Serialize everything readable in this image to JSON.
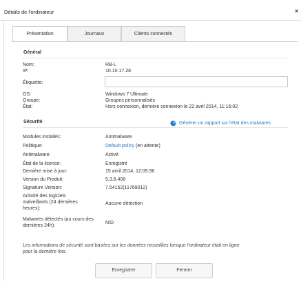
{
  "dialog": {
    "title": "Détails de l'ordinateur",
    "close_label": "×"
  },
  "tabs": [
    {
      "label": "Présentation",
      "active": true
    },
    {
      "label": "Journaux",
      "active": false
    },
    {
      "label": "Clients connectés",
      "active": false
    }
  ],
  "general": {
    "title": "Général",
    "name_label": "Nom:",
    "name_value": "RB-L",
    "ip_label": "IP:",
    "ip_value": "10.10.17.28",
    "tag_label": "Étiquette:",
    "tag_value": "",
    "os_label": "OS:",
    "os_value": "Windows 7 Ultimate",
    "group_label": "Groupe:",
    "group_value": "Groupes personnalisés",
    "state_label": "État:",
    "state_value": "Hors connexion, dernière connexion le 22 avril 2014, 11:16:02"
  },
  "security": {
    "title": "Sécurité",
    "report_link": "Générer un rapport sur l'état des malwares",
    "modules_label": "Modules installés:",
    "modules_value": "Antimalware",
    "policy_label": "Politique:",
    "policy_link": "Default policy",
    "policy_suffix": "(en attente)",
    "antimalware_label": "Antimalware:",
    "antimalware_value": "Activé",
    "license_label": "État de la licence:",
    "license_value": "Enregistré",
    "last_update_label": "Dernière mise à jour:",
    "last_update_value": "15 avril 2014, 12:05:36",
    "product_version_label": "Version du Produit:",
    "product_version_value": "5.3.8.408",
    "signature_label": "Signature Version:",
    "signature_value": "7.54152(11769012)",
    "activity_label_1": "Activité des logiciels",
    "activity_label_2": "malveillants (24 dernières",
    "activity_label_3": "heures):",
    "activity_value": "Aucune détection",
    "detected_label_1": "Malwares détectés (au cours des",
    "detected_label_2": "dernières 24h):",
    "detected_value": "N/D"
  },
  "note": {
    "line1": "Les informations de sécurité sont basées sur les données recueillies lorsque l'ordinateur était en ligne",
    "line2": "pour la dernière fois."
  },
  "buttons": {
    "save_label": "Enregistrer",
    "close_label": "Fermer"
  },
  "colors": {
    "link": "#2a7bc4",
    "report_icon": "#2a7bc4"
  }
}
